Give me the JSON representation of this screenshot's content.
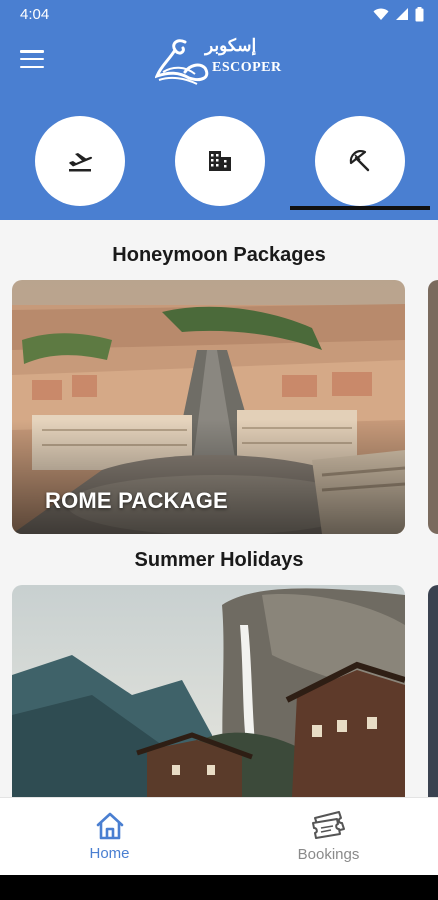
{
  "status_bar": {
    "time": "4:04"
  },
  "header": {
    "logo_arabic": "إسكوبر",
    "logo_text": "ESCOPER",
    "categories": [
      {
        "icon": "flight-departure-icon"
      },
      {
        "icon": "hotel-building-icon"
      },
      {
        "icon": "beach-umbrella-icon",
        "selected": true
      }
    ]
  },
  "sections": [
    {
      "title": "Honeymoon Packages",
      "card_label": "ROME PACKAGE"
    },
    {
      "title": "Summer Holidays",
      "card_label": ""
    }
  ],
  "bottom_nav": {
    "home_label": "Home",
    "bookings_label": "Bookings",
    "active": "home"
  },
  "colors": {
    "primary": "#4a7fd1",
    "active_nav": "#4a7fd1",
    "inactive_nav": "#8a8a8a"
  }
}
